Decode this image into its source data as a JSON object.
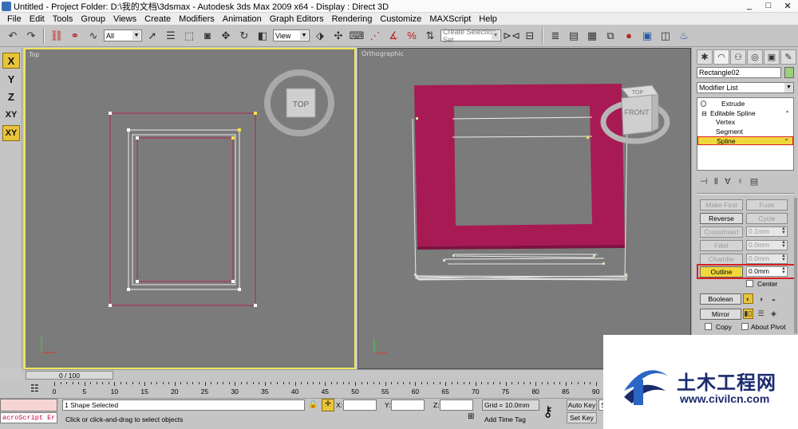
{
  "window": {
    "title": "Untitled    - Project Folder: D:\\我的文档\\3dsmax    - Autodesk 3ds Max  2009 x64    - Display : Direct 3D",
    "controls": [
      "_",
      "□",
      "✕"
    ]
  },
  "menu": [
    "File",
    "Edit",
    "Tools",
    "Group",
    "Views",
    "Create",
    "Modifiers",
    "Animation",
    "Graph Editors",
    "Rendering",
    "Customize",
    "MAXScript",
    "Help"
  ],
  "toolbar": {
    "selection_filter": "All",
    "reference_coord": "View",
    "named_selection_placeholder": "Create Selection Set"
  },
  "axis_constraints": [
    "X",
    "Y",
    "Z",
    "XY",
    "XY"
  ],
  "viewports": {
    "top": {
      "label": "Top",
      "viewcube": "TOP"
    },
    "ortho": {
      "label": "Orthographic",
      "viewcube_front": "FRONT",
      "viewcube_top": "TOP"
    }
  },
  "command_panel": {
    "object_name": "Rectangle02",
    "object_color": "#9ccf7d",
    "modifier_list": "Modifier List",
    "stack": {
      "extrude": "Extrude",
      "editable_spline": "Editable Spline",
      "vertex": "Vertex",
      "segment": "Segment",
      "spline": "Spline"
    },
    "buttons": {
      "make_first": "Make First",
      "fuse": "Fuse",
      "reverse": "Reverse",
      "cycle": "Cycle",
      "cross_insert": "CrossInsert",
      "fillet": "Fillet",
      "chamfer": "Chamfer",
      "outline": "Outline",
      "boolean": "Boolean",
      "mirror": "Mirror"
    },
    "values": {
      "cross_insert": "0.1mm",
      "fillet": "0.0mm",
      "chamfer": "0.0mm",
      "outline": "0.0mm"
    },
    "center_label": "Center",
    "copy_label": "Copy",
    "about_pivot_label": "About Pivot"
  },
  "timeline": {
    "slider": "0 / 100",
    "ticks": [
      "0",
      "5",
      "10",
      "15",
      "20",
      "25",
      "30",
      "35",
      "40",
      "45",
      "50",
      "55",
      "60",
      "65",
      "70",
      "75",
      "80",
      "85",
      "90"
    ]
  },
  "status": {
    "maxscript": "acroScript Er",
    "selection": "1 Shape Selected",
    "prompt": "Click or click-and-drag to select objects",
    "x_label": "X:",
    "y_label": "Y:",
    "z_label": "Z:",
    "grid": "Grid = 10.0mm",
    "add_time_tag": "Add Time Tag",
    "auto_key": "Auto Key",
    "set_key": "Set Key",
    "sel_field": "S"
  },
  "watermark": {
    "cn": "土木工程网",
    "url": "www.civilcn.com"
  }
}
